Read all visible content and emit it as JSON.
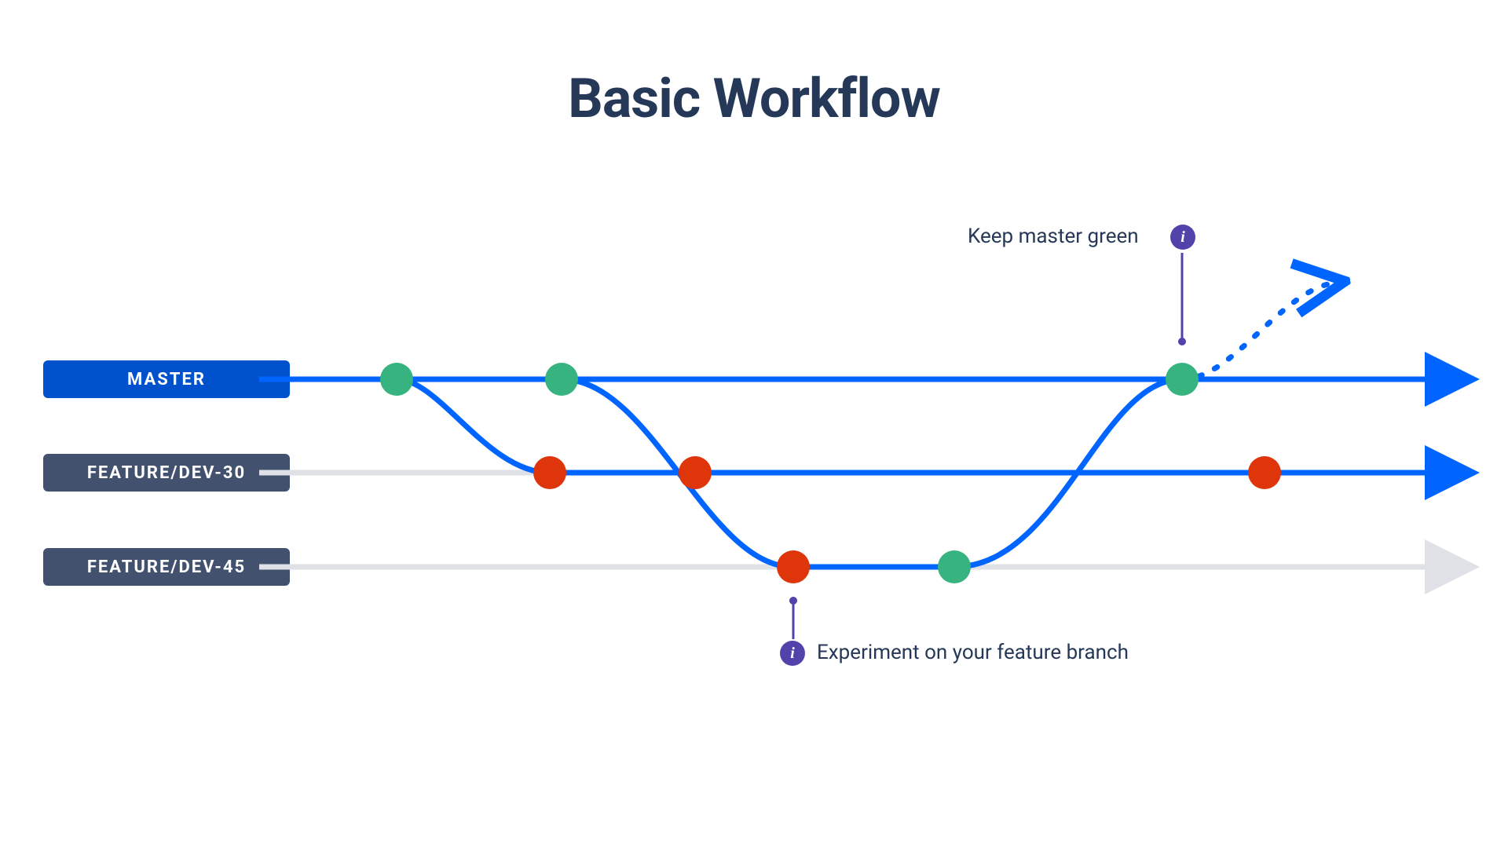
{
  "title": "Basic Workflow",
  "branches": {
    "master": {
      "label": "MASTER",
      "color": "#0052cc",
      "bg": "#0052cc"
    },
    "f30": {
      "label": "FEATURE/DEV-30",
      "color": "#42526e",
      "bg": "#42526e"
    },
    "f45": {
      "label": "FEATURE/DEV-45",
      "color": "#42526e",
      "bg": "#42526e"
    }
  },
  "annotations": {
    "top": "Keep master green",
    "bottom": "Experiment on your feature branch"
  },
  "colors": {
    "green": "#36b37e",
    "red": "#de350b",
    "blue": "#0065ff",
    "grey": "#dfe1e6",
    "purple": "#5243aa",
    "dark": "#253858"
  }
}
